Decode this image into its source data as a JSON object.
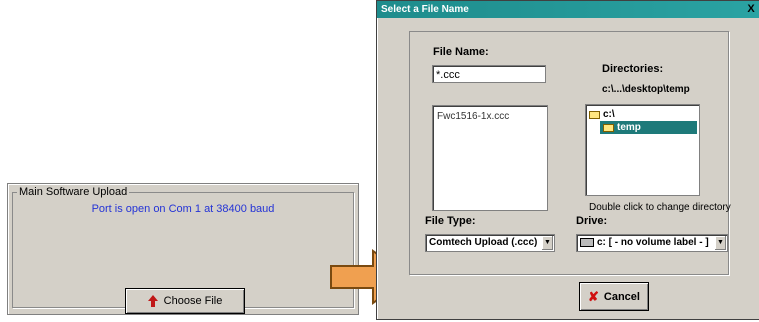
{
  "upload_panel": {
    "group_title": "Main Software Upload",
    "port_status": "Port is open on Com 1 at 38400 baud",
    "choose_button": "Choose File"
  },
  "dialog": {
    "title": "Select a File Name",
    "close_glyph": "X",
    "file_name_label": "File Name:",
    "file_name_value": "*.ccc",
    "files": [
      "Fwc1516-1x.ccc"
    ],
    "directories_label": "Directories:",
    "directory_path": "c:\\...\\desktop\\temp",
    "directory_tree": [
      {
        "name": "c:\\",
        "selected": false
      },
      {
        "name": "temp",
        "selected": true
      }
    ],
    "dir_hint": "Double click to change directory",
    "file_type_label": "File Type:",
    "file_type_value": "Comtech Upload (.ccc)",
    "drive_label": "Drive:",
    "drive_value": "c: [ - no volume label - ]",
    "cancel_button": "Cancel"
  },
  "colors": {
    "titlebar": "#1e8c8c",
    "port_status_text": "#2433d6",
    "arrow": "#f0a050",
    "cancel_x": "#d01010"
  }
}
